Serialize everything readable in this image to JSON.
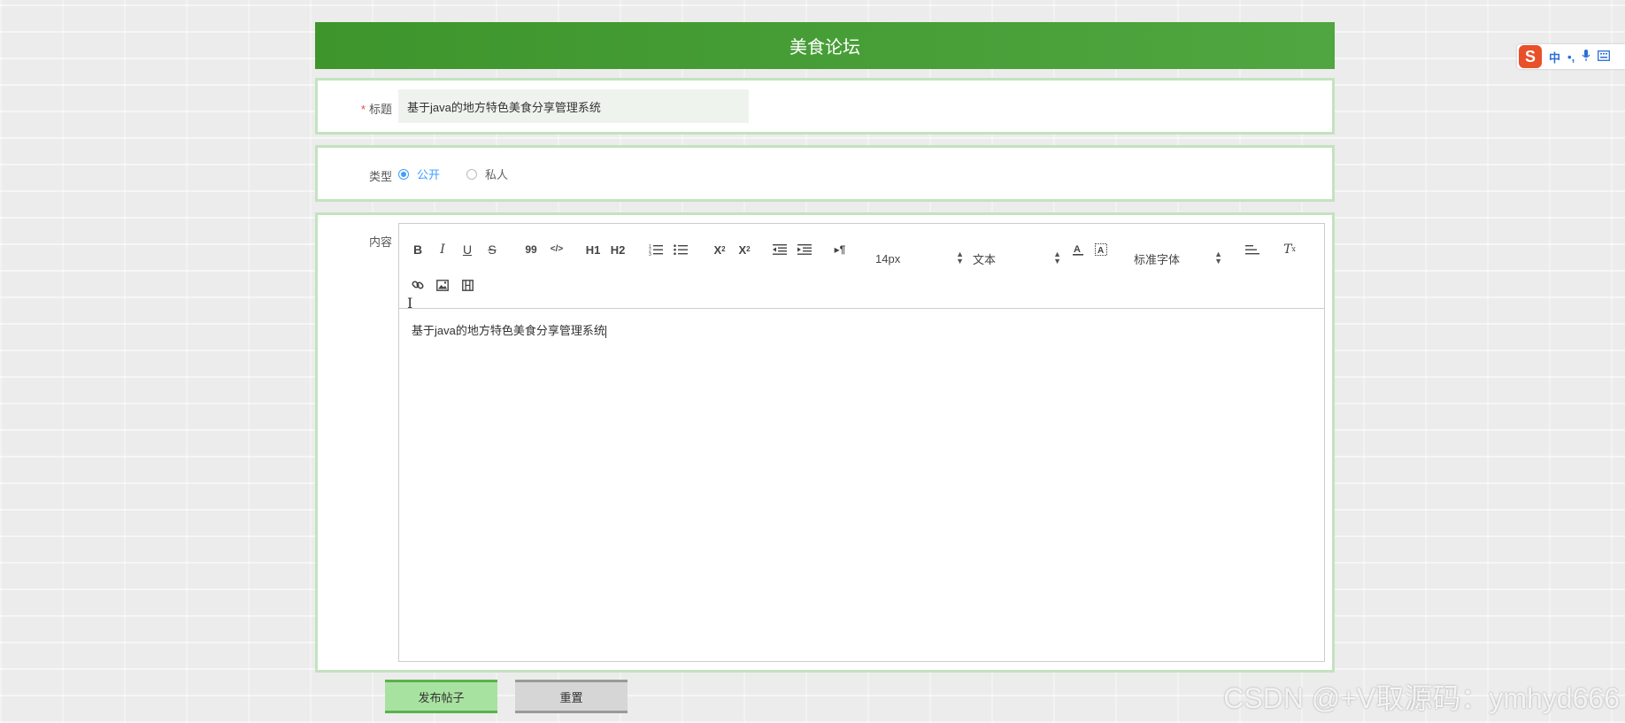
{
  "header": {
    "title": "美食论坛"
  },
  "form": {
    "title_label": "标题",
    "required_mark": "*",
    "title_value": "基于java的地方特色美食分享管理系统",
    "type_label": "类型",
    "type_options": [
      {
        "label": "公开",
        "selected": true
      },
      {
        "label": "私人",
        "selected": false
      }
    ],
    "content_label": "内容",
    "content_text": "基于java的地方特色美食分享管理系统"
  },
  "toolbar": {
    "bold": "B",
    "italic": "I",
    "underline": "U",
    "strike": "S",
    "blockquote": "99",
    "code": "</>",
    "h1": "H1",
    "h2": "H2",
    "subscript": "X2",
    "superscript": "X2",
    "direction": "▸¶",
    "size_picker": "14px",
    "header_picker": "文本",
    "font_picker": "标准字体",
    "clean": "Tx"
  },
  "buttons": {
    "submit": "发布帖子",
    "reset": "重置"
  },
  "ime": {
    "logo": "S",
    "lang": "中",
    "punct": "•,"
  },
  "watermark": "CSDN @+V取源码：ymhyd666",
  "colors": {
    "header_green": "#3d952c",
    "panel_border": "#c3e3bf",
    "accent": "#409eff",
    "submit_bg": "#a8e2a0"
  }
}
